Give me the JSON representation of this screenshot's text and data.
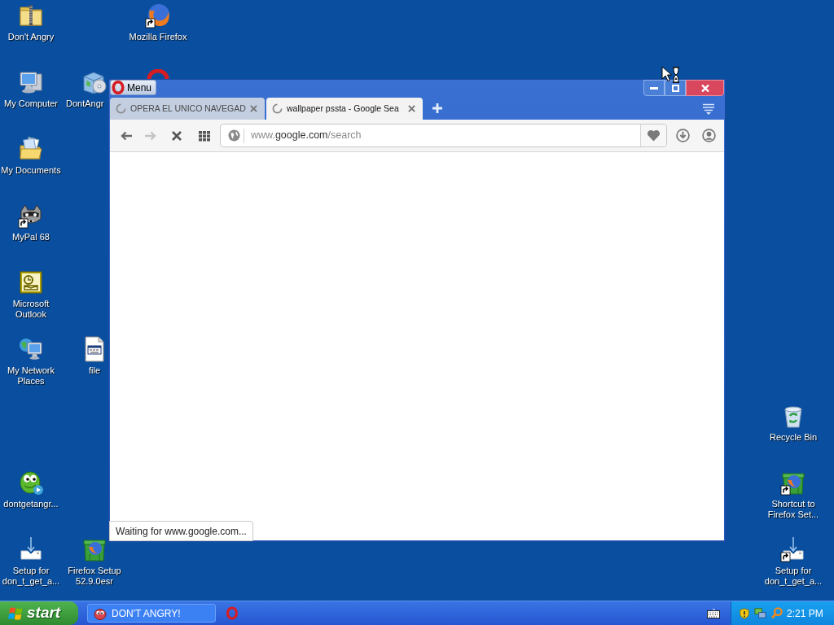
{
  "desktop": {
    "icons": [
      {
        "label": "Don't Angry",
        "kind": "zip_folder",
        "shortcut": false
      },
      {
        "label": "Mozilla Firefox",
        "kind": "browser_globe",
        "shortcut": true
      },
      {
        "label": "My Computer",
        "kind": "computer",
        "shortcut": false
      },
      {
        "label": "DontAngr",
        "kind": "installer",
        "shortcut": false
      },
      {
        "kind": "ring_partial"
      },
      {
        "label": "My Documents",
        "kind": "documents",
        "shortcut": false
      },
      {
        "label": "MyPal 68",
        "kind": "raccoon",
        "shortcut": true
      },
      {
        "label": "Microsoft Outlook",
        "kind": "outlook",
        "shortcut": false
      },
      {
        "label": "My Network Places",
        "kind": "network",
        "shortcut": false
      },
      {
        "label": "file",
        "kind": "file",
        "shortcut": false
      },
      {
        "label": "Recycle Bin",
        "kind": "recycle_bin",
        "shortcut": false
      },
      {
        "label": "dontgetangr...",
        "kind": "creature",
        "shortcut": false
      },
      {
        "label": "Shortcut to Firefox Set...",
        "kind": "box_globe",
        "shortcut": true
      },
      {
        "label": "Setup for don_t_get_a...",
        "kind": "setup",
        "shortcut": false
      },
      {
        "label": "Firefox Setup 52.9.0esr",
        "kind": "box_globe",
        "shortcut": false
      },
      {
        "label": "Setup for don_t_get_a...",
        "kind": "setup",
        "shortcut": true
      }
    ]
  },
  "browser": {
    "menu_button": {
      "label": "Menu"
    },
    "tabs": [
      {
        "title": "OPERA EL UNICO NAVEGAD",
        "selected": false
      },
      {
        "title": "wallpaper pssta - Google Sea",
        "selected": true
      }
    ],
    "toolbar": {
      "buttons": [
        {
          "kind": "back",
          "disabled": false
        },
        {
          "kind": "forward",
          "disabled": true
        },
        {
          "kind": "stop",
          "disabled": false
        },
        {
          "kind": "speed_dial",
          "disabled": false
        }
      ]
    },
    "address": {
      "prefix": "www.",
      "domain": "google.com",
      "path": "/search"
    },
    "status": "Waiting for www.google.com..."
  },
  "taskbar": {
    "start_label": "start",
    "tasks": [
      {
        "label": "DON'T ANGRY!",
        "selected": false
      }
    ],
    "clock": "2:21 PM"
  }
}
